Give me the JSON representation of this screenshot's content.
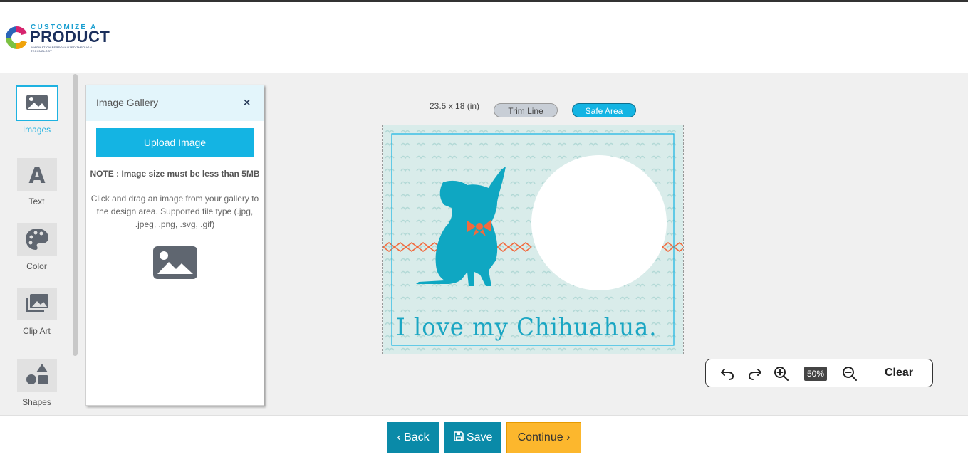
{
  "brand": {
    "top": "CUSTOMIZE A",
    "main": "PRODUCT",
    "tagline": "IMAGINATION PERSONALIZED THROUGH TECHNOLOGY"
  },
  "sidebar": {
    "items": [
      {
        "label": "Images",
        "icon": "image-icon",
        "active": true
      },
      {
        "label": "Text",
        "icon": "text-icon",
        "active": false
      },
      {
        "label": "Color",
        "icon": "palette-icon",
        "active": false
      },
      {
        "label": "Clip Art",
        "icon": "clip-art-icon",
        "active": false
      },
      {
        "label": "Shapes",
        "icon": "shapes-icon",
        "active": false
      }
    ]
  },
  "gallery": {
    "title": "Image Gallery",
    "close": "×",
    "upload_label": "Upload Image",
    "note": "NOTE : Image size must be less than 5MB",
    "help": "Click and drag an image from your gallery to the design area. Supported file type (.jpg, .jpeg, .png, .svg, .gif)"
  },
  "design": {
    "dimensions": "23.5 x 18 (in)",
    "trim_label": "Trim Line",
    "safe_label": "Safe Area",
    "caption": "I love my Chihuahua."
  },
  "zoom": {
    "level": "50%",
    "clear_label": "Clear"
  },
  "footer": {
    "back_label": "Back",
    "save_label": "Save",
    "continue_label": "Continue"
  },
  "colors": {
    "accent": "#14b4e3",
    "footer_primary": "#0a8aa8",
    "continue": "#fcb72d",
    "canvas_bg": "#d9ecea",
    "dog": "#0fa7c2",
    "collar": "#f26a3d"
  }
}
